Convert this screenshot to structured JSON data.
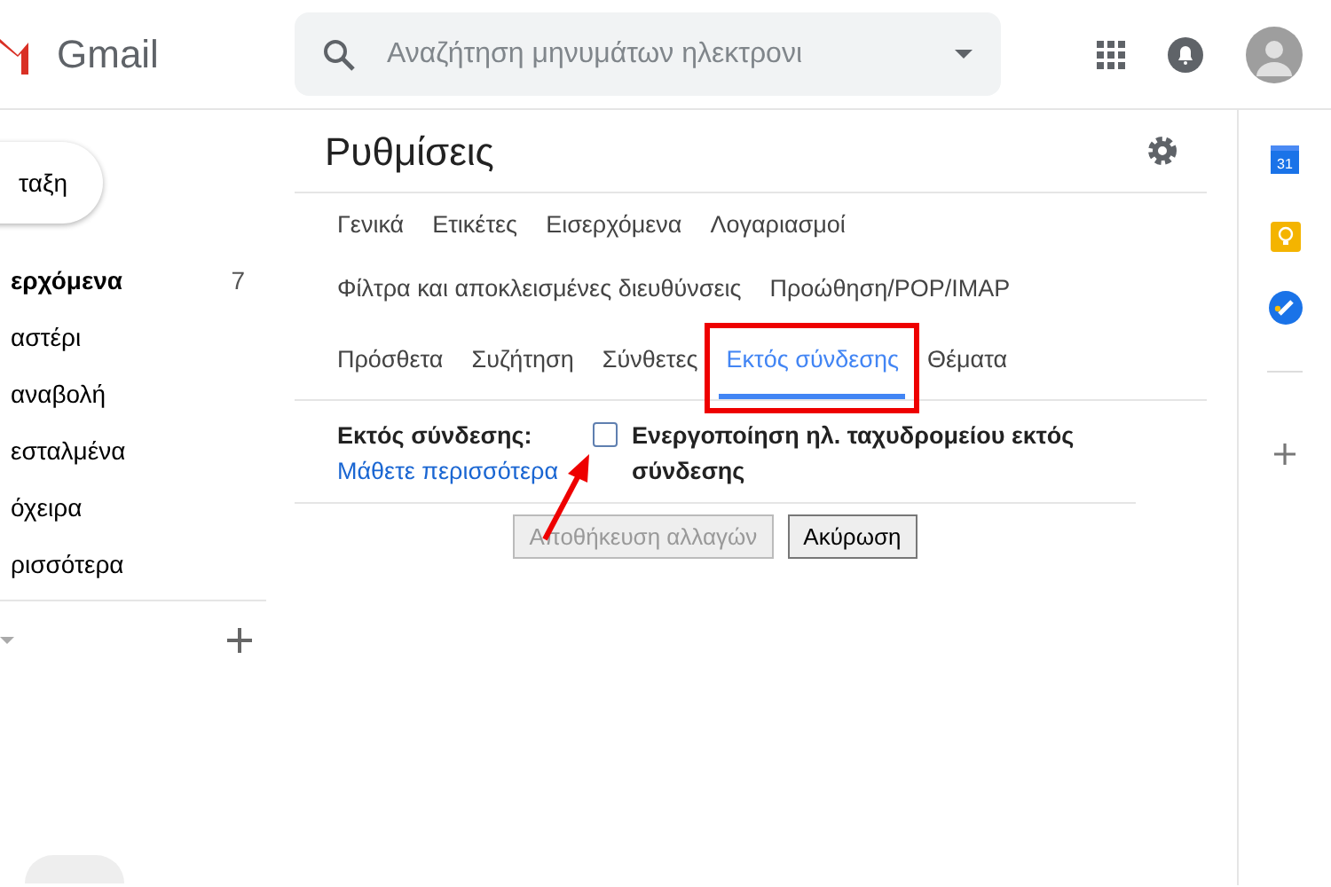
{
  "header": {
    "app_name": "Gmail",
    "search": {
      "placeholder": "Αναζήτηση μηνυμάτων ηλεκτρονι"
    }
  },
  "sidebar": {
    "compose": "ταξη",
    "items": [
      {
        "label": "ερχόμενα",
        "count": "7",
        "selected": true
      },
      {
        "label": "αστέρι",
        "selected": false
      },
      {
        "label": "αναβολή",
        "selected": false
      },
      {
        "label": "εσταλμένα",
        "selected": false
      },
      {
        "label": "όχειρα",
        "selected": false
      },
      {
        "label": "ρισσότερα",
        "selected": false
      }
    ]
  },
  "settings": {
    "title": "Ρυθμίσεις",
    "tab_rows": [
      [
        {
          "label": "Γενικά",
          "selected": false
        },
        {
          "label": "Ετικέτες",
          "selected": false
        },
        {
          "label": "Εισερχόμενα",
          "selected": false
        },
        {
          "label": "Λογαριασμοί",
          "selected": false
        }
      ],
      [
        {
          "label": "Φίλτρα και αποκλεισμένες διευθύνσεις",
          "selected": false
        },
        {
          "label": "Προώθηση/POP/IMAP",
          "selected": false
        }
      ],
      [
        {
          "label": "Πρόσθετα",
          "selected": false
        },
        {
          "label": "Συζήτηση",
          "selected": false
        },
        {
          "label": "Σύνθετες",
          "selected": false
        },
        {
          "label": "Εκτός σύνδεσης",
          "selected": true
        },
        {
          "label": "Θέματα",
          "selected": false
        }
      ]
    ],
    "offline": {
      "label": "Εκτός σύνδεσης:",
      "checkbox": {
        "text": "Ενεργοποίηση ηλ. ταχυδρομείου εκτός σύνδεσης",
        "checked": false
      },
      "link": "Μάθετε περισσότερα"
    },
    "buttons": [
      {
        "label": "Αποθήκευση αλλαγών",
        "disabled": true
      },
      {
        "label": "Ακύρωση",
        "disabled": false
      }
    ]
  },
  "side_apps": {
    "calendar_day": "31"
  }
}
